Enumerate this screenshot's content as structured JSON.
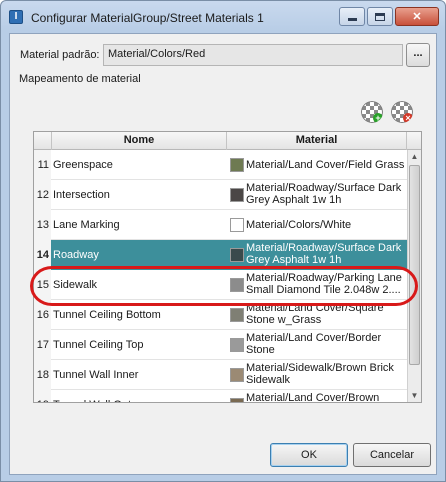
{
  "window": {
    "title": "Configurar MaterialGroup/Street Materials 1",
    "app_icon_letter": "I"
  },
  "form": {
    "default_material_label": "Material padrão:",
    "default_material_value": "Material/Colors/Red",
    "browse_label": "...",
    "mapping_label": "Mapeamento de material"
  },
  "toolbar": {
    "add_icon": "add-material-icon",
    "remove_icon": "remove-material-icon"
  },
  "table": {
    "columns": [
      "Nome",
      "Material"
    ],
    "rows": [
      {
        "num": "11",
        "name": "Greenspace",
        "material": "Material/Land Cover/Field Grass",
        "swatch": "#6e7a52"
      },
      {
        "num": "12",
        "name": "Intersection",
        "material": "Material/Roadway/Surface Dark Grey Asphalt 1w 1h",
        "swatch": "#4b4746"
      },
      {
        "num": "13",
        "name": "Lane Marking",
        "material": "Material/Colors/White",
        "swatch": "#ffffff"
      },
      {
        "num": "14",
        "name": "Roadway",
        "material": "Material/Roadway/Surface Dark Grey Asphalt 1w 1h",
        "swatch": "#3a4a4c",
        "selected": true
      },
      {
        "num": "15",
        "name": "Sidewalk",
        "material": "Material/Roadway/Parking Lane Small Diamond Tile 2.048w 2....",
        "swatch": "#8c8c8c"
      },
      {
        "num": "16",
        "name": "Tunnel Ceiling Bottom",
        "material": "Material/Land Cover/Square Stone w_Grass",
        "swatch": "#7f7f74"
      },
      {
        "num": "17",
        "name": "Tunnel Ceiling Top",
        "material": "Material/Land Cover/Border Stone",
        "swatch": "#9a9a9a"
      },
      {
        "num": "18",
        "name": "Tunnel Wall Inner",
        "material": "Material/Sidewalk/Brown Brick Sidewalk",
        "swatch": "#9b8a74"
      },
      {
        "num": "19",
        "name": "Tunnel Wall Outer",
        "material": "Material/Land Cover/Brown",
        "swatch": "#7a6a52"
      }
    ]
  },
  "buttons": {
    "ok": "OK",
    "cancel": "Cancelar"
  },
  "colors": {
    "selection": "#3d8f9b",
    "highlight_ring": "#d81919"
  }
}
